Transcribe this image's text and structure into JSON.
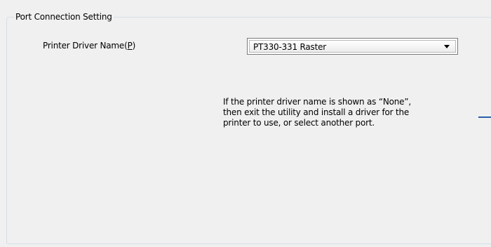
{
  "group": {
    "title": "Port Connection Setting"
  },
  "printer_driver": {
    "label_prefix": "Printer Driver Name(",
    "label_accesskey": "P",
    "label_suffix": ")",
    "selected_value": "PT330-331 Raster",
    "dropdown_icon": "chevron-down-icon"
  },
  "note": {
    "lines": [
      "If the printer driver name is shown as “None”,",
      "then exit the utility and install a driver for the",
      "printer to use, or select another port."
    ]
  },
  "colors": {
    "background": "#f0f0f0",
    "accent_line": "#2a5fa8"
  }
}
